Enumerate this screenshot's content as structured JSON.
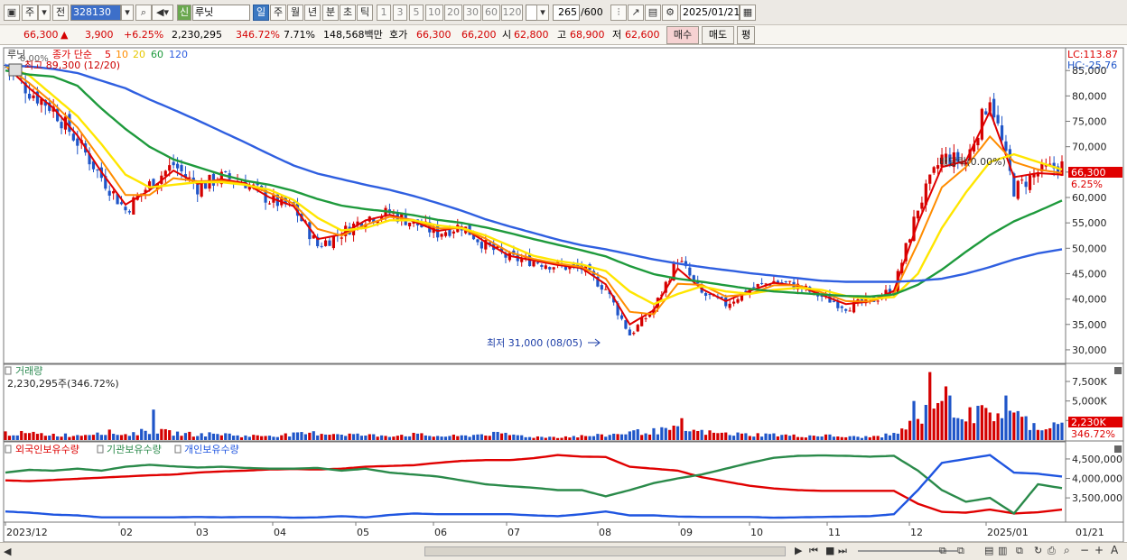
{
  "toolbar": {
    "market_tab": "주",
    "prev_label": "전",
    "code_value": "328130",
    "badge_new": "신",
    "stock_name": "루닛",
    "periods": [
      "일",
      "주",
      "월",
      "년",
      "분",
      "초",
      "틱"
    ],
    "intervals": [
      "1",
      "3",
      "5",
      "10",
      "20",
      "30",
      "60",
      "120"
    ],
    "count_value": "265",
    "count_total": "/600",
    "date_value": "2025/01/21"
  },
  "quote": {
    "price": "66,300",
    "change": "3,900",
    "change_pct": "+6.25%",
    "volume": "2,230,295",
    "volume_ratio": "346.72%",
    "turnover_pct": "7.71%",
    "amount": "148,568백만",
    "bid_label": "호가",
    "bid1": "66,300",
    "bid2": "66,200",
    "open_label": "시",
    "open": "62,800",
    "high_label": "고",
    "high": "68,900",
    "low_label": "저",
    "low": "62,600",
    "buy_label": "매수",
    "sell_label": "매도",
    "eval_label": "평"
  },
  "colors": {
    "up": "#d40000",
    "down": "#1f55c8",
    "ma5": "#e00000",
    "ma10": "#ff8c00",
    "ma20": "#ffe600",
    "ma60": "#1e9a3c",
    "ma120": "#2f5fe0",
    "foreign": "#e00000",
    "institution": "#2a8a4a",
    "individual": "#1f55e0"
  },
  "chart_data": [
    {
      "type": "line",
      "title": "루닛",
      "legend_label": "종가 단순",
      "ma_periods": [
        "5",
        "10",
        "20",
        "60",
        "120"
      ],
      "annotations": {
        "high_label": "최고 89,300 (12/20)",
        "low_label": "최저 31,000 (08/05)",
        "dividend_label": "배당락(0.00%)",
        "lc_label": "LC:113.87",
        "hc_label": "HC:-25.76",
        "last_price_tag": "66,300",
        "last_pct_tag": "6.25%",
        "pct_tag": "0.00%"
      },
      "y_ticks": [
        "85,000",
        "80,000",
        "75,000",
        "70,000",
        "65,000",
        "60,000",
        "55,000",
        "50,000",
        "45,000",
        "40,000",
        "35,000",
        "30,000"
      ],
      "ylim": [
        27500,
        89300
      ],
      "x_tick_labels": [
        "2023/12",
        "02",
        "03",
        "04",
        "05",
        "06",
        "07",
        "08",
        "09",
        "10",
        "11",
        "12",
        "2025/01",
        "01/21"
      ],
      "close_series": {
        "name": "종가",
        "x": [
          0,
          6,
          12,
          18,
          24,
          30,
          36,
          42,
          48,
          54,
          60,
          66,
          72,
          78,
          84,
          90,
          96,
          102,
          108,
          114,
          120,
          126,
          132,
          138,
          144,
          150,
          156,
          162,
          168,
          174,
          180,
          186,
          192,
          198,
          204,
          210,
          216,
          222,
          228,
          234,
          240,
          246,
          252,
          258,
          264
        ],
        "values": [
          86000,
          81000,
          77500,
          71000,
          64000,
          57500,
          62500,
          66500,
          62000,
          64000,
          63000,
          59500,
          58000,
          50500,
          53000,
          56000,
          57000,
          55000,
          53000,
          54500,
          50500,
          48000,
          47500,
          46500,
          46000,
          42000,
          33000,
          38000,
          48000,
          41000,
          39000,
          42000,
          43500,
          42500,
          40500,
          38500,
          39500,
          42000,
          58000,
          68000,
          67000,
          80000,
          61500,
          65000,
          66300
        ]
      },
      "ma_series": [
        {
          "name": "5",
          "values": [
            86000,
            81500,
            77600,
            72200,
            65000,
            58600,
            61400,
            65300,
            62700,
            63600,
            62800,
            60000,
            58300,
            51800,
            52700,
            55500,
            56600,
            55300,
            53400,
            54200,
            51200,
            48500,
            47600,
            46700,
            46100,
            42900,
            35000,
            37800,
            46000,
            42000,
            39600,
            41600,
            43200,
            42600,
            40800,
            39000,
            39500,
            41600,
            55000,
            66000,
            67200,
            77000,
            64000,
            64800,
            64500
          ]
        },
        {
          "name": "10",
          "values": [
            86000,
            82500,
            78500,
            73800,
            67300,
            60500,
            60500,
            63800,
            63200,
            63300,
            62600,
            60900,
            58800,
            53800,
            52500,
            54600,
            56200,
            55600,
            53900,
            53900,
            51900,
            49200,
            47900,
            47000,
            46300,
            44000,
            37500,
            37000,
            43000,
            42800,
            40500,
            41000,
            42700,
            42700,
            41300,
            39600,
            39500,
            41000,
            51000,
            62000,
            66000,
            72000,
            67000,
            65500,
            64800
          ]
        },
        {
          "name": "20",
          "values": [
            86000,
            84000,
            80000,
            76000,
            70500,
            64500,
            62000,
            62500,
            63000,
            63000,
            62500,
            61500,
            59500,
            56000,
            53500,
            54000,
            55500,
            55500,
            54500,
            54000,
            52500,
            50500,
            48500,
            47500,
            46800,
            45500,
            41500,
            39000,
            41000,
            42500,
            41500,
            41000,
            41800,
            42200,
            41800,
            40600,
            40000,
            40400,
            45000,
            54000,
            61000,
            67000,
            68500,
            67000,
            65500
          ]
        },
        {
          "name": "60",
          "values": [
            85000,
            84200,
            83800,
            82000,
            77500,
            73500,
            70000,
            67500,
            66000,
            64500,
            63300,
            62500,
            61300,
            59700,
            58400,
            57700,
            57200,
            56500,
            55600,
            55000,
            54100,
            53000,
            51800,
            50700,
            49600,
            48400,
            46500,
            44900,
            44000,
            43400,
            42700,
            42000,
            41500,
            41200,
            40900,
            40600,
            40500,
            40900,
            42800,
            45800,
            49300,
            52600,
            55300,
            57300,
            59400
          ]
        },
        {
          "name": "120",
          "values": [
            86000,
            85800,
            85300,
            84500,
            83000,
            81500,
            79300,
            77300,
            75200,
            73000,
            70800,
            68500,
            66300,
            64700,
            63600,
            62500,
            61500,
            60300,
            58900,
            57400,
            55700,
            54300,
            53000,
            51700,
            50600,
            49800,
            48800,
            47800,
            47000,
            46300,
            45700,
            45100,
            44600,
            44100,
            43600,
            43400,
            43400,
            43400,
            43600,
            44000,
            45000,
            46300,
            47800,
            49000,
            49800
          ]
        }
      ]
    },
    {
      "type": "bar",
      "title": "거래량",
      "value_label": "2,230,295주(346.72%)",
      "y_ticks": [
        "7,500K",
        "5,000K",
        "2,500K"
      ],
      "last_tag": "2,230K",
      "pct_tag": "346.72%",
      "ylim": [
        0,
        9000
      ],
      "x": [
        0,
        6,
        12,
        18,
        24,
        30,
        36,
        42,
        48,
        54,
        60,
        66,
        72,
        78,
        84,
        90,
        96,
        102,
        108,
        114,
        120,
        126,
        132,
        138,
        144,
        150,
        156,
        162,
        168,
        174,
        180,
        186,
        192,
        198,
        204,
        210,
        216,
        222,
        228,
        234,
        240,
        246,
        252,
        258,
        264
      ],
      "values": [
        900,
        800,
        700,
        600,
        1100,
        700,
        1200,
        900,
        700,
        800,
        500,
        600,
        700,
        900,
        800,
        600,
        600,
        700,
        500,
        500,
        800,
        700,
        400,
        400,
        500,
        600,
        1000,
        1100,
        1400,
        1000,
        800,
        700,
        700,
        500,
        600,
        400,
        400,
        700,
        2500,
        5500,
        3000,
        3500,
        3200,
        1600,
        2230
      ],
      "spikes": [
        {
          "x": 37,
          "v": 3900
        },
        {
          "x": 169,
          "v": 2800
        },
        {
          "x": 227,
          "v": 5000
        },
        {
          "x": 231,
          "v": 8700
        },
        {
          "x": 234,
          "v": 5000
        },
        {
          "x": 241,
          "v": 4200
        },
        {
          "x": 250,
          "v": 5700
        },
        {
          "x": 264,
          "v": 2230
        }
      ]
    },
    {
      "type": "line",
      "title": "외국인보유수량",
      "legend": [
        "외국인보유수량",
        "기관보유수량",
        "개인보유수량"
      ],
      "y_ticks": [
        "4,500,000",
        "4,000,000",
        "3,500,000"
      ],
      "ylim": [
        2900000,
        4800000
      ],
      "x": [
        0,
        6,
        12,
        18,
        24,
        30,
        36,
        42,
        48,
        54,
        60,
        66,
        72,
        78,
        84,
        90,
        96,
        102,
        108,
        114,
        120,
        126,
        132,
        138,
        144,
        150,
        156,
        162,
        168,
        174,
        180,
        186,
        192,
        198,
        204,
        210,
        216,
        222,
        228,
        234,
        240,
        246,
        252,
        258,
        264
      ],
      "series": [
        {
          "name": "외국인보유수량",
          "values": [
            3950000,
            3930000,
            3960000,
            3990000,
            4020000,
            4050000,
            4080000,
            4100000,
            4150000,
            4180000,
            4200000,
            4230000,
            4240000,
            4230000,
            4250000,
            4300000,
            4320000,
            4340000,
            4400000,
            4450000,
            4470000,
            4470000,
            4520000,
            4600000,
            4560000,
            4550000,
            4300000,
            4250000,
            4200000,
            4030000,
            3920000,
            3810000,
            3740000,
            3700000,
            3680000,
            3680000,
            3680000,
            3680000,
            3350000,
            3140000,
            3120000,
            3200000,
            3100000,
            3130000,
            3200000
          ]
        },
        {
          "name": "기관보유수량",
          "values": [
            4150000,
            4220000,
            4200000,
            4250000,
            4200000,
            4300000,
            4350000,
            4310000,
            4280000,
            4300000,
            4270000,
            4250000,
            4250000,
            4270000,
            4200000,
            4250000,
            4150000,
            4100000,
            4050000,
            3950000,
            3850000,
            3800000,
            3760000,
            3700000,
            3700000,
            3540000,
            3700000,
            3880000,
            4000000,
            4100000,
            4250000,
            4400000,
            4530000,
            4580000,
            4590000,
            4580000,
            4560000,
            4580000,
            4200000,
            3700000,
            3400000,
            3500000,
            3100000,
            3850000,
            3750000
          ]
        },
        {
          "name": "개인보유수량",
          "values": [
            3150000,
            3120000,
            3070000,
            3050000,
            3000000,
            3000000,
            3000000,
            3000000,
            3010000,
            3000000,
            3010000,
            3010000,
            2990000,
            3000000,
            3030000,
            3000000,
            3060000,
            3100000,
            3080000,
            3080000,
            3080000,
            3080000,
            3050000,
            3030000,
            3080000,
            3150000,
            3050000,
            3050000,
            3020000,
            3010000,
            3010000,
            3010000,
            2990000,
            3000000,
            3010000,
            3020000,
            3030000,
            3080000,
            3700000,
            4400000,
            4500000,
            4600000,
            4150000,
            4120000,
            4050000
          ]
        }
      ]
    }
  ]
}
